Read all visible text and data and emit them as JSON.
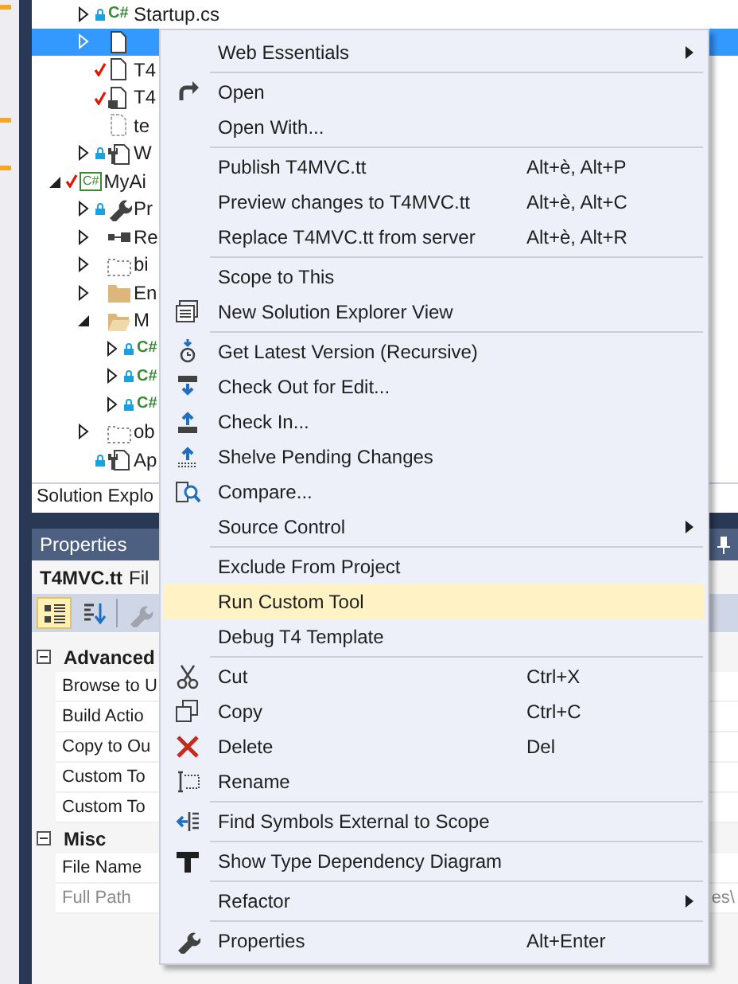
{
  "solution_explorer": {
    "partial_items": [
      {
        "label": "Startup.cs",
        "expanded": false,
        "kind": "cs",
        "badge": "C#",
        "checked": false,
        "locked": true,
        "selected": false
      },
      {
        "expanded": false,
        "kind": "file",
        "checked": false,
        "locked": false,
        "selected": true
      },
      {
        "label": "T4",
        "kind": "file",
        "checked": true,
        "locked": false,
        "selected": false
      },
      {
        "label": "T4",
        "kind": "file-lock",
        "checked": true,
        "locked": false,
        "selected": false
      },
      {
        "label": "te",
        "kind": "file-dashed",
        "checked": false,
        "locked": false,
        "selected": false
      },
      {
        "label": "W",
        "expanded": false,
        "kind": "config",
        "checked": false,
        "locked": true,
        "selected": false
      }
    ],
    "items": [
      {
        "label": "MyAi",
        "expanded": true,
        "kind": "csproj",
        "badge": "C#",
        "checked": true,
        "locked": false,
        "selected": false,
        "children": [
          {
            "label": "Pr",
            "expanded": false,
            "kind": "wrench",
            "checked": false,
            "locked": true,
            "selected": false
          },
          {
            "label": "Re",
            "expanded": false,
            "kind": "refs",
            "checked": false,
            "locked": false,
            "selected": false
          },
          {
            "label": "bi",
            "expanded": false,
            "kind": "folder-dashed",
            "checked": false,
            "locked": false,
            "selected": false
          },
          {
            "label": "En",
            "expanded": false,
            "kind": "folder",
            "checked": false,
            "locked": false,
            "selected": false
          },
          {
            "label": "M",
            "expanded": true,
            "kind": "folder-open",
            "checked": false,
            "locked": false,
            "selected": false,
            "children": [
              {
                "expanded": false,
                "kind": "cs",
                "badge": "C#",
                "checked": false,
                "locked": true,
                "selected": false
              },
              {
                "expanded": false,
                "kind": "cs",
                "badge": "C#",
                "checked": false,
                "locked": true,
                "selected": false
              },
              {
                "expanded": false,
                "kind": "cs",
                "badge": "C#",
                "checked": false,
                "locked": true,
                "selected": false
              }
            ]
          },
          {
            "label": "ob",
            "expanded": false,
            "kind": "folder-dashed",
            "checked": false,
            "locked": false,
            "selected": false
          },
          {
            "label": "Ap",
            "kind": "config",
            "checked": false,
            "locked": true,
            "selected": false
          }
        ]
      }
    ],
    "tab": "Solution Explo"
  },
  "properties": {
    "title": "Properties",
    "object_name": "T4MVC.tt",
    "object_type": "Fil",
    "toolbar": [
      {
        "kind": "categorized",
        "selected": true
      },
      {
        "kind": "alphabetical",
        "selected": false
      },
      {
        "kind": "wrench",
        "selected": false
      }
    ],
    "groups": [
      {
        "name": "Advanced",
        "expanded": true,
        "rows": [
          {
            "name": "Browse to U",
            "disabled": false
          },
          {
            "name": "Build Actio",
            "disabled": false
          },
          {
            "name": "Copy to Ou",
            "disabled": false
          },
          {
            "name": "Custom To",
            "disabled": false
          },
          {
            "name": "Custom To",
            "disabled": false
          }
        ]
      },
      {
        "name": "Misc",
        "expanded": true,
        "rows": [
          {
            "name": "File Name",
            "disabled": false
          },
          {
            "name": "Full Path",
            "disabled": true,
            "value": "es\\"
          }
        ]
      }
    ]
  },
  "context_menu": [
    {
      "kind": "submenu",
      "label": "Web Essentials",
      "selected": false
    },
    {
      "kind": "separator"
    },
    {
      "kind": "open",
      "label": "Open",
      "selected": false
    },
    {
      "kind": "plain",
      "label": "Open With...",
      "selected": false
    },
    {
      "kind": "separator"
    },
    {
      "kind": "plain",
      "label": "Publish T4MVC.tt",
      "shortcut": "Alt+è, Alt+P",
      "selected": false
    },
    {
      "kind": "plain",
      "label": "Preview changes to T4MVC.tt",
      "shortcut": "Alt+è, Alt+C",
      "selected": false
    },
    {
      "kind": "plain",
      "label": "Replace T4MVC.tt from server",
      "shortcut": "Alt+è, Alt+R",
      "selected": false
    },
    {
      "kind": "separator"
    },
    {
      "kind": "plain",
      "label": "Scope to This",
      "selected": false
    },
    {
      "kind": "newview",
      "label": "New Solution Explorer View",
      "selected": false
    },
    {
      "kind": "separator"
    },
    {
      "kind": "getlatest",
      "label": "Get Latest Version (Recursive)",
      "selected": false
    },
    {
      "kind": "checkout",
      "label": "Check Out for Edit...",
      "selected": false
    },
    {
      "kind": "checkin",
      "label": "Check In...",
      "selected": false
    },
    {
      "kind": "shelve",
      "label": "Shelve Pending Changes",
      "selected": false
    },
    {
      "kind": "compare",
      "label": "Compare...",
      "selected": false
    },
    {
      "kind": "submenu",
      "label": "Source Control",
      "selected": false
    },
    {
      "kind": "separator"
    },
    {
      "kind": "plain",
      "label": "Exclude From Project",
      "selected": false
    },
    {
      "kind": "plain",
      "label": "Run Custom Tool",
      "selected": true
    },
    {
      "kind": "plain",
      "label": "Debug T4 Template",
      "selected": false
    },
    {
      "kind": "separator"
    },
    {
      "kind": "cut",
      "label": "Cut",
      "shortcut": "Ctrl+X",
      "selected": false
    },
    {
      "kind": "copy",
      "label": "Copy",
      "shortcut": "Ctrl+C",
      "selected": false
    },
    {
      "kind": "delete",
      "label": "Delete",
      "shortcut": "Del",
      "selected": false
    },
    {
      "kind": "rename",
      "label": "Rename",
      "selected": false
    },
    {
      "kind": "separator"
    },
    {
      "kind": "findsymbols",
      "label": "Find Symbols External to Scope",
      "selected": false
    },
    {
      "kind": "separator"
    },
    {
      "kind": "typediagram",
      "label": "Show Type Dependency Diagram",
      "selected": false
    },
    {
      "kind": "separator"
    },
    {
      "kind": "submenu",
      "label": "Refactor",
      "selected": false
    },
    {
      "kind": "separator"
    },
    {
      "kind": "wrench",
      "label": "Properties",
      "shortcut": "Alt+Enter",
      "selected": false
    }
  ]
}
